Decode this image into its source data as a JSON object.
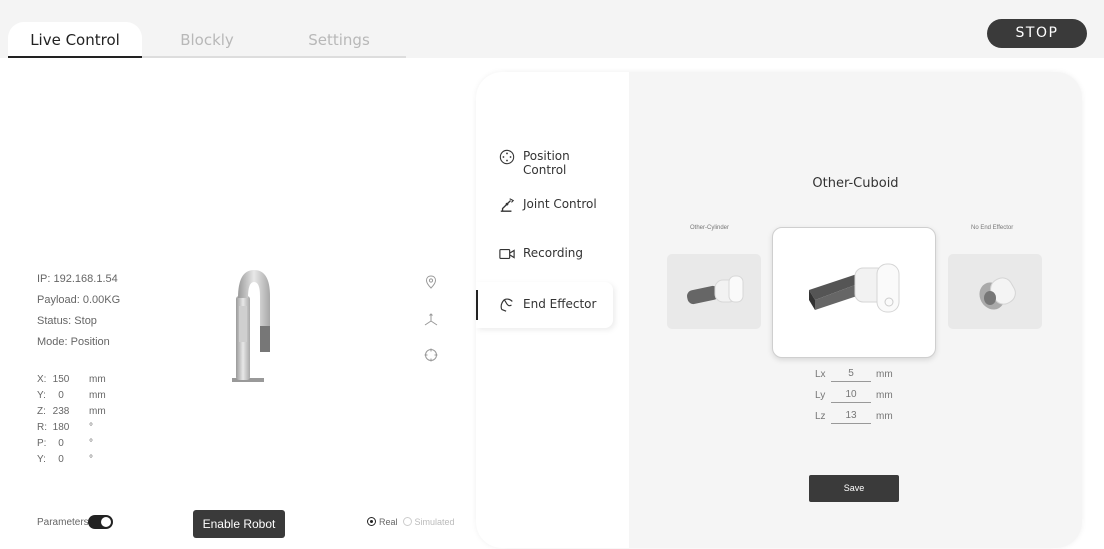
{
  "tabs": [
    {
      "label": "Live Control"
    },
    {
      "label": "Blockly"
    },
    {
      "label": "Settings"
    }
  ],
  "stop_label": "STOP",
  "robot_info": {
    "ip": "IP: 192.168.1.54",
    "payload": "Payload: 0.00KG",
    "status": "Status: Stop",
    "mode": "Mode: Position"
  },
  "coordinates": [
    {
      "axis": "X:",
      "value": "150",
      "unit": "mm"
    },
    {
      "axis": "Y:",
      "value": "0",
      "unit": "mm"
    },
    {
      "axis": "Z:",
      "value": "238",
      "unit": "mm"
    },
    {
      "axis": "R:",
      "value": "180",
      "unit": "°"
    },
    {
      "axis": "P:",
      "value": "0",
      "unit": "°"
    },
    {
      "axis": "Y:",
      "value": "0",
      "unit": "°"
    }
  ],
  "parameters_label": "Parameters",
  "parameters_on": true,
  "enable_label": "Enable Robot",
  "mode_options": {
    "real": "Real",
    "simulated": "Simulated",
    "selected": "Real"
  },
  "side_icons": [
    "location-pin-icon",
    "axes-icon",
    "crosshair-icon"
  ],
  "nav": [
    {
      "label": "Position Control",
      "icon": "dpad-icon"
    },
    {
      "label": "Joint Control",
      "icon": "robot-arm-icon"
    },
    {
      "label": "Recording",
      "icon": "video-camera-icon"
    },
    {
      "label": "End Effector",
      "icon": "gripper-icon",
      "active": true
    }
  ],
  "end_effector": {
    "title": "Other-Cuboid",
    "left_option": "Other-Cylinder",
    "right_option": "No End Effector",
    "dims": [
      {
        "label": "Lx",
        "value": "5",
        "unit": "mm"
      },
      {
        "label": "Ly",
        "value": "10",
        "unit": "mm"
      },
      {
        "label": "Lz",
        "value": "13",
        "unit": "mm"
      }
    ],
    "save_label": "Save"
  },
  "colors": {
    "dark": "#3a3a3a",
    "topbar": "#f4f4f4",
    "card": "#f5f5f5"
  }
}
